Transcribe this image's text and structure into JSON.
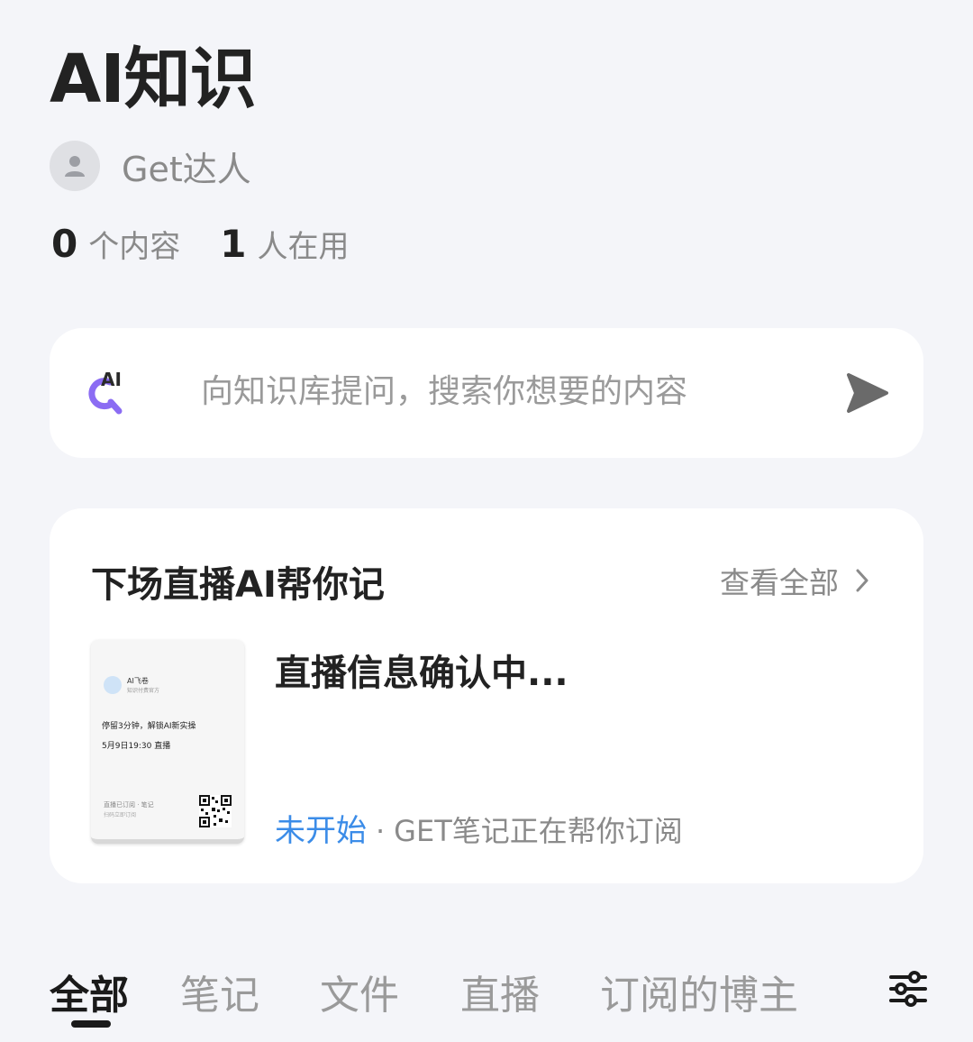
{
  "header": {
    "title": "AI知识",
    "author_name": "Get达人"
  },
  "stats": {
    "content_count": "0",
    "content_label": "个内容",
    "user_count": "1",
    "user_label": "人在用"
  },
  "search": {
    "icon_text": "AI",
    "placeholder": "向知识库提问，搜索你想要的内容"
  },
  "live_card": {
    "title": "下场直播AI帮你记",
    "view_all": "查看全部",
    "poster": {
      "account_name": "AI飞卷",
      "account_sub": "知识付费官方",
      "line1": "停留3分钟，解锁AI新实操",
      "line2": "5月9日19:30 直播",
      "footer1": "直播已订阅 · 笔记",
      "footer2": "扫码立即订阅"
    },
    "item_title": "直播信息确认中...",
    "status": "未开始",
    "separator": "·",
    "status_desc": "GET笔记正在帮你订阅"
  },
  "tabs": [
    {
      "label": "全部",
      "active": true
    },
    {
      "label": "笔记",
      "active": false
    },
    {
      "label": "文件",
      "active": false
    },
    {
      "label": "直播",
      "active": false
    },
    {
      "label": "订阅的博主",
      "active": false
    }
  ],
  "colors": {
    "background": "#f4f5f9",
    "accent_blue": "#3b8ce8",
    "ai_icon_purple": "#8b6cf3"
  },
  "icons": {
    "avatar": "user-avatar-icon",
    "search": "ai-search-icon",
    "send": "send-icon",
    "chevron": "chevron-right-icon",
    "filter": "filter-sliders-icon"
  }
}
